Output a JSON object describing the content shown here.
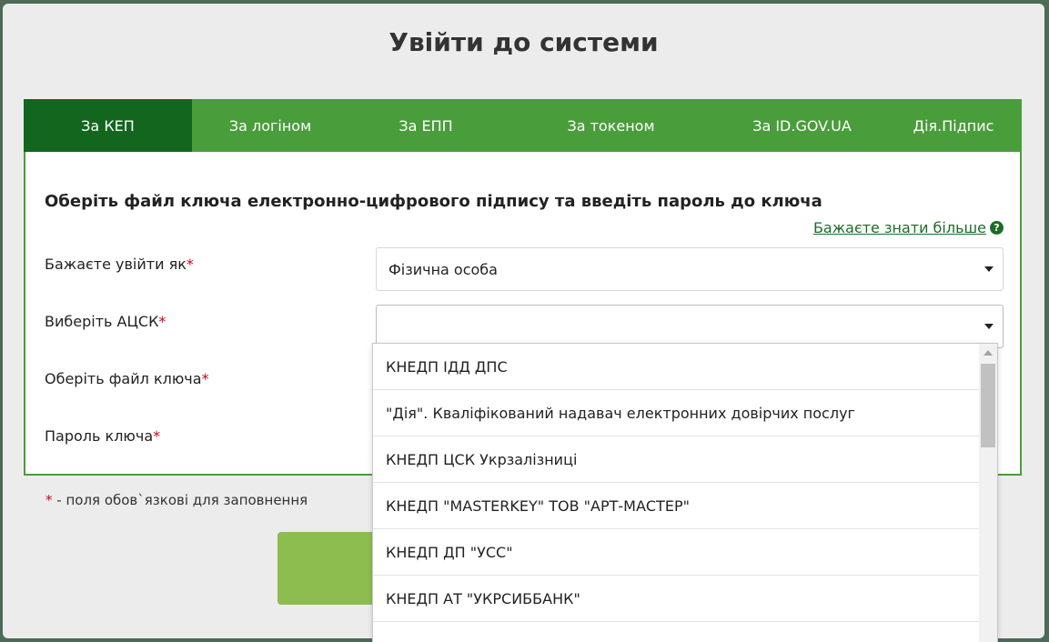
{
  "modal": {
    "title": "Увійти до системи"
  },
  "tabs": [
    {
      "label": "За КЕП",
      "active": true
    },
    {
      "label": "За логіном",
      "active": false
    },
    {
      "label": "За ЕПП",
      "active": false
    },
    {
      "label": "За токеном",
      "active": false
    },
    {
      "label": "За ID.GOV.UA",
      "active": false
    },
    {
      "label": "Дія.Підпис",
      "active": false
    }
  ],
  "form": {
    "heading": "Оберіть файл ключа електронно-цифрового підпису та введіть пароль до ключа",
    "learn_more": "Бажаєте знати більше",
    "login_as_label": "Бажаєте увійти як",
    "login_as_value": "Фізична особа",
    "acsk_label": "Виберіть АЦСК",
    "acsk_value": "",
    "key_file_label": "Оберіть файл ключа",
    "password_label": "Пароль ключа",
    "required_mark": "*",
    "required_hint": "- поля обов`язкові для заповнення"
  },
  "acsk_options": [
    "КНЕДП ІДД ДПС",
    "\"Дія\". Кваліфікований надавач електронних довірчих послуг",
    "КНЕДП ЦСК Укрзалізниці",
    "КНЕДП \"MASTERKEY\" ТОВ \"АРТ-МАСТЕР\"",
    "КНЕДП ДП \"УСС\"",
    "КНЕДП АТ \"УКРСИББАНК\""
  ],
  "colors": {
    "tab_bar": "#4a9d3b",
    "tab_active": "#12661d",
    "link": "#1e6b2b",
    "required": "#d0021b",
    "button": "#8ebd4f"
  }
}
